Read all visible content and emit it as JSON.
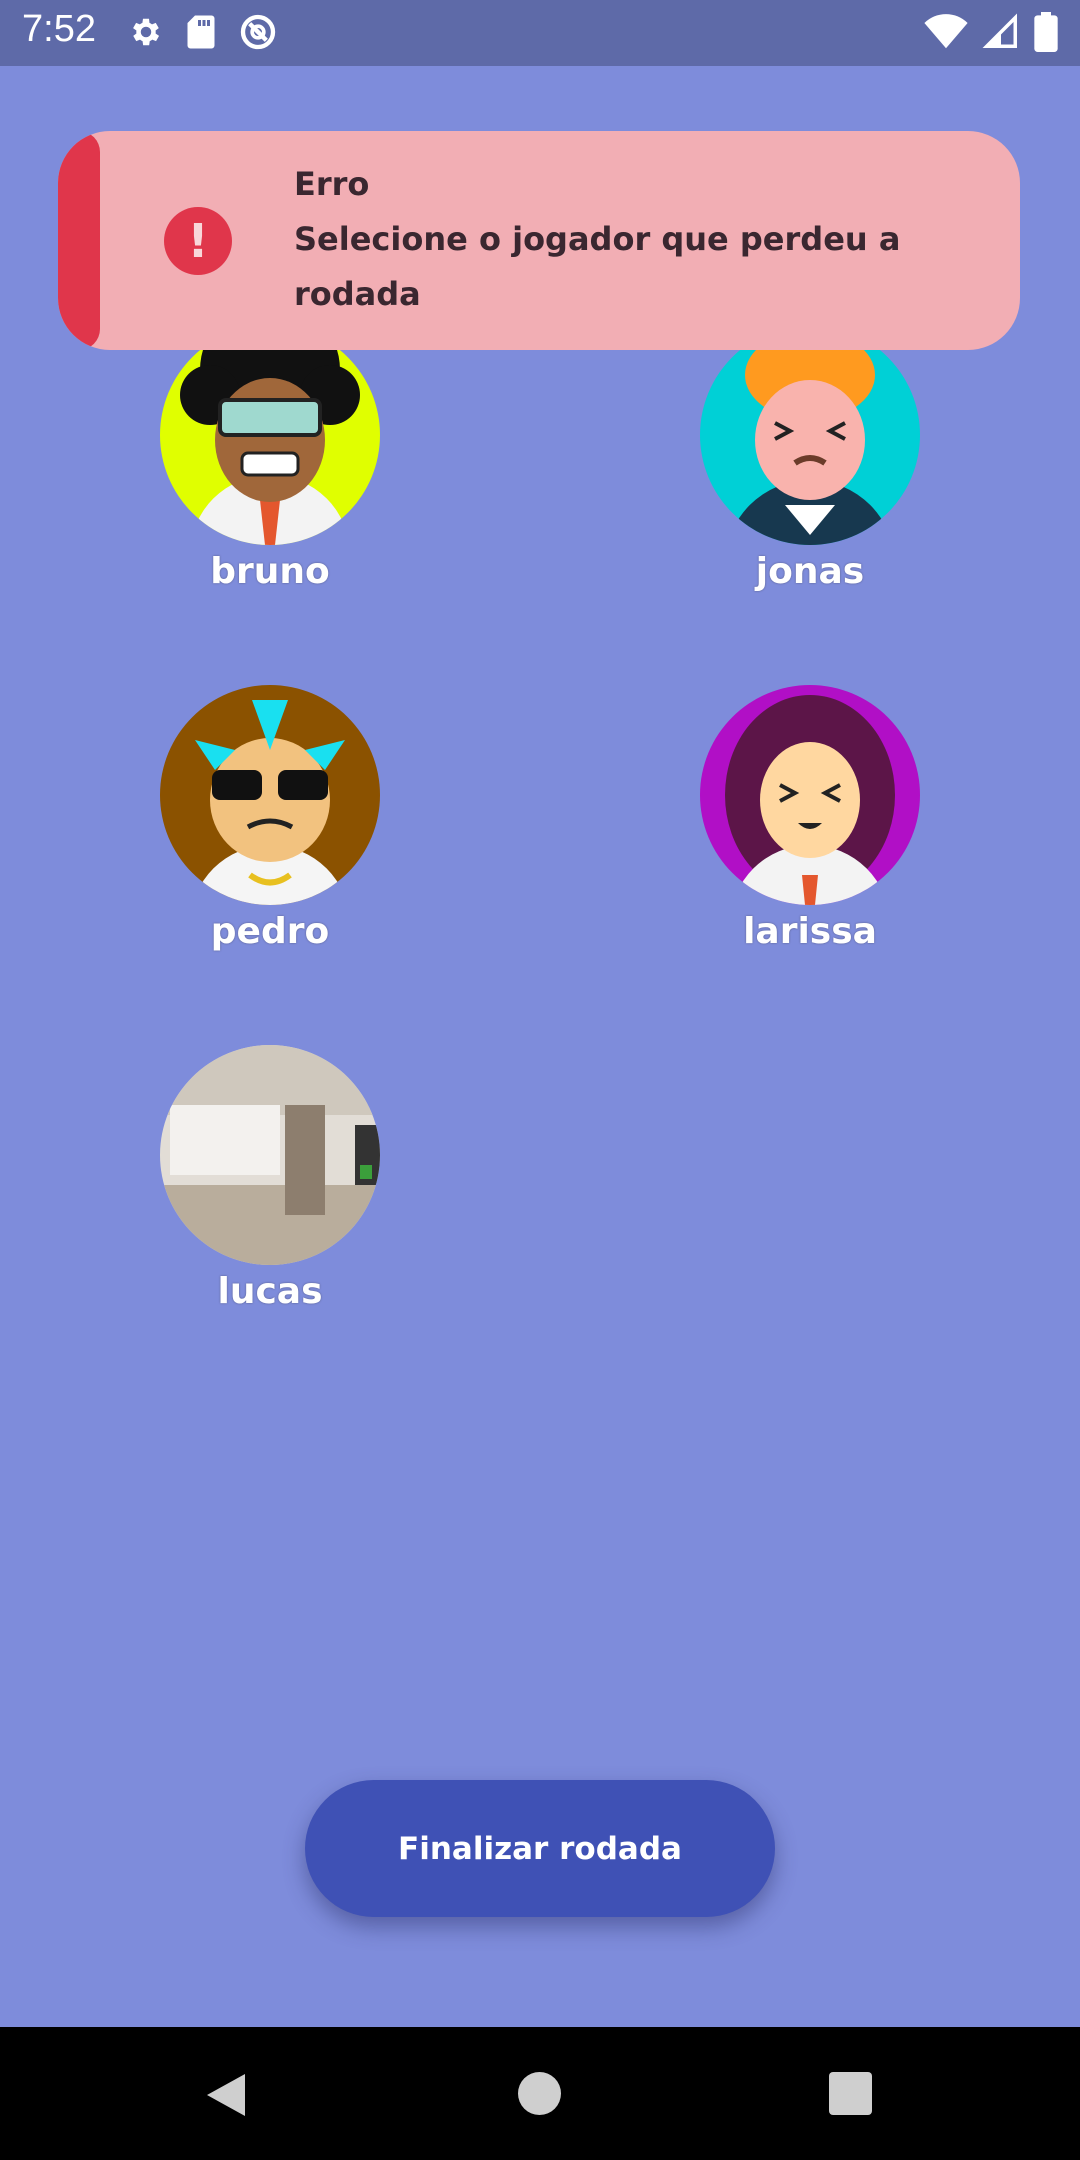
{
  "status_bar": {
    "time": "7:52",
    "left_icons": [
      "gear-icon",
      "sd-card-icon",
      "vpn-key-icon"
    ],
    "right_icons": [
      "wifi-icon",
      "signal-icon",
      "battery-icon"
    ]
  },
  "toast": {
    "title": "Erro",
    "message": "Selecione o jogador que perdeu a rodada",
    "icon": "error-icon",
    "accent_color": "#e0364b",
    "background_color": "#f2aeb4"
  },
  "players": [
    {
      "name": "bruno",
      "avatar": "afro-sunglasses-avatar"
    },
    {
      "name": "jonas",
      "avatar": "orange-hair-avatar"
    },
    {
      "name": "pedro",
      "avatar": "mohawk-sunglasses-avatar"
    },
    {
      "name": "larissa",
      "avatar": "purple-hair-avatar"
    },
    {
      "name": "lucas",
      "avatar": "room-photo-avatar"
    }
  ],
  "finish_button": {
    "label": "Finalizar rodada",
    "color": "#3f51b5"
  },
  "nav_bar": {
    "icons": [
      "back-icon",
      "home-icon",
      "recents-icon"
    ]
  },
  "colors": {
    "background": "#7e8cdb",
    "status_bar": "#5e6aa8"
  }
}
